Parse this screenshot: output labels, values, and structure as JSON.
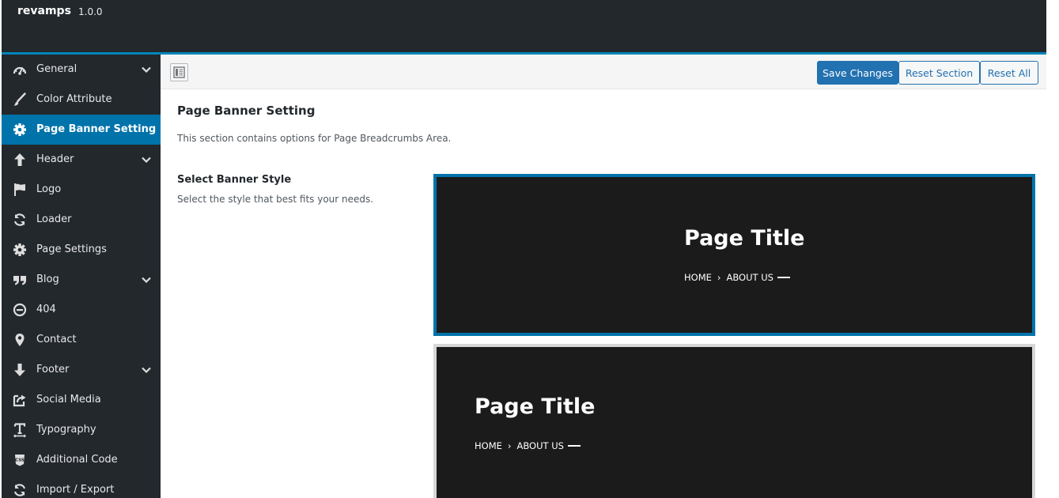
{
  "app": {
    "name": "revamps",
    "version": "1.0.0"
  },
  "sidebar": {
    "items": [
      {
        "label": "General",
        "icon": "dashboard-icon",
        "has_children": true
      },
      {
        "label": "Color Attribute",
        "icon": "brush-icon",
        "has_children": false
      },
      {
        "label": "Page Banner Setting",
        "icon": "gear-icon",
        "has_children": false,
        "active": true
      },
      {
        "label": "Header",
        "icon": "arrow-up-icon",
        "has_children": true
      },
      {
        "label": "Logo",
        "icon": "flag-icon",
        "has_children": false
      },
      {
        "label": "Loader",
        "icon": "refresh-icon",
        "has_children": false
      },
      {
        "label": "Page Settings",
        "icon": "gear-icon",
        "has_children": false
      },
      {
        "label": "Blog",
        "icon": "quote-icon",
        "has_children": true
      },
      {
        "label": "404",
        "icon": "minus-circle-icon",
        "has_children": false
      },
      {
        "label": "Contact",
        "icon": "map-pin-icon",
        "has_children": false
      },
      {
        "label": "Footer",
        "icon": "arrow-down-icon",
        "has_children": true
      },
      {
        "label": "Social Media",
        "icon": "share-icon",
        "has_children": false
      },
      {
        "label": "Typography",
        "icon": "text-icon",
        "has_children": false
      },
      {
        "label": "Additional Code",
        "icon": "css-icon",
        "has_children": false
      },
      {
        "label": "Import / Export",
        "icon": "refresh-icon",
        "has_children": false
      }
    ]
  },
  "toolbar": {
    "save_label": "Save Changes",
    "reset_section_label": "Reset Section",
    "reset_all_label": "Reset All"
  },
  "section": {
    "title": "Page Banner Setting",
    "description": "This section contains options for Page Breadcrumbs Area."
  },
  "field": {
    "title": "Select Banner Style",
    "description": "Select the style that best fits your needs.",
    "options": [
      {
        "title": "Page Title",
        "crumb_home": "HOME",
        "crumb_sep": "›",
        "crumb_current": "ABOUT US",
        "align": "center",
        "selected": true
      },
      {
        "title": "Page Title",
        "crumb_home": "HOME",
        "crumb_sep": "›",
        "crumb_current": "ABOUT US",
        "align": "left",
        "selected": false
      }
    ]
  },
  "colors": {
    "topbar": "#23282d",
    "accent": "#0085ba",
    "active_item": "#0073aa",
    "primary_button": "#2271b1",
    "banner_bg": "#1b1b1b"
  }
}
